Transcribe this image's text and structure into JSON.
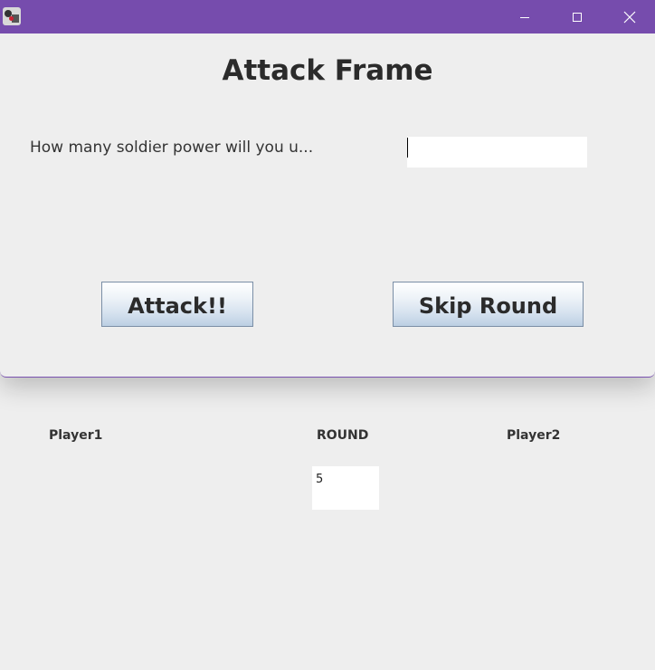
{
  "main_window": {
    "player1_label": "Player1",
    "round_label": "ROUND",
    "player2_label": "Player2",
    "round_value": "5"
  },
  "dialog": {
    "title": "Attack Frame",
    "question": "How many soldier power will you u...",
    "input_value": "",
    "attack_label": "Attack!!",
    "skip_label": "Skip Round"
  },
  "colors": {
    "titlebar": "#764cad",
    "window_bg": "#eeeeee"
  },
  "icons": {
    "app": "app-icon",
    "minimize": "minimize-icon",
    "maximize": "maximize-icon",
    "close": "close-icon"
  }
}
